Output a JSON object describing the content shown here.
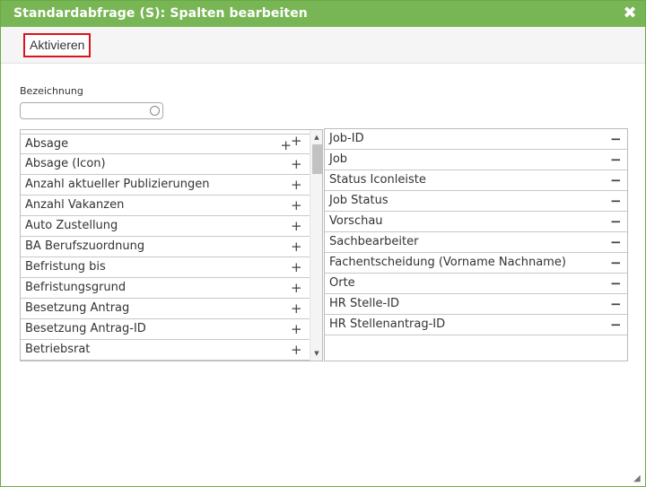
{
  "dialog": {
    "title": "Standardabfrage (S): Spalten bearbeiten",
    "close_icon": "close-icon",
    "close_glyph": "✖"
  },
  "toolbar": {
    "activate_label": "Aktivieren"
  },
  "filter": {
    "label": "Bezeichnung",
    "value": "",
    "placeholder": ""
  },
  "available_columns": [
    {
      "label": "Absage",
      "action": "+"
    },
    {
      "label": "Absage (Icon)",
      "action": "+"
    },
    {
      "label": "Anzahl aktueller Publizierungen",
      "action": "+"
    },
    {
      "label": "Anzahl Vakanzen",
      "action": "+"
    },
    {
      "label": "Auto Zustellung",
      "action": "+"
    },
    {
      "label": "BA Berufszuordnung",
      "action": "+"
    },
    {
      "label": "Befristung bis",
      "action": "+"
    },
    {
      "label": "Befristungsgrund",
      "action": "+"
    },
    {
      "label": "Besetzung Antrag",
      "action": "+"
    },
    {
      "label": "Besetzung Antrag-ID",
      "action": "+"
    },
    {
      "label": "Betriebsrat",
      "action": "+"
    }
  ],
  "selected_columns": [
    {
      "label": "Job-ID",
      "action": "−"
    },
    {
      "label": "Job",
      "action": "−"
    },
    {
      "label": "Status Iconleiste",
      "action": "−"
    },
    {
      "label": "Job Status",
      "action": "−"
    },
    {
      "label": "Vorschau",
      "action": "−"
    },
    {
      "label": "Sachbearbeiter",
      "action": "−"
    },
    {
      "label": "Fachentscheidung (Vorname Nachname)",
      "action": "−"
    },
    {
      "label": "Orte",
      "action": "−"
    },
    {
      "label": "HR Stelle-ID",
      "action": "−"
    },
    {
      "label": "HR Stellenantrag-ID",
      "action": "−"
    }
  ],
  "scrollbar": {
    "up_glyph": "▲",
    "down_glyph": "▼",
    "position": 0.0
  },
  "colors": {
    "titlebar": "#78b554",
    "highlight_border": "#d9141c"
  }
}
